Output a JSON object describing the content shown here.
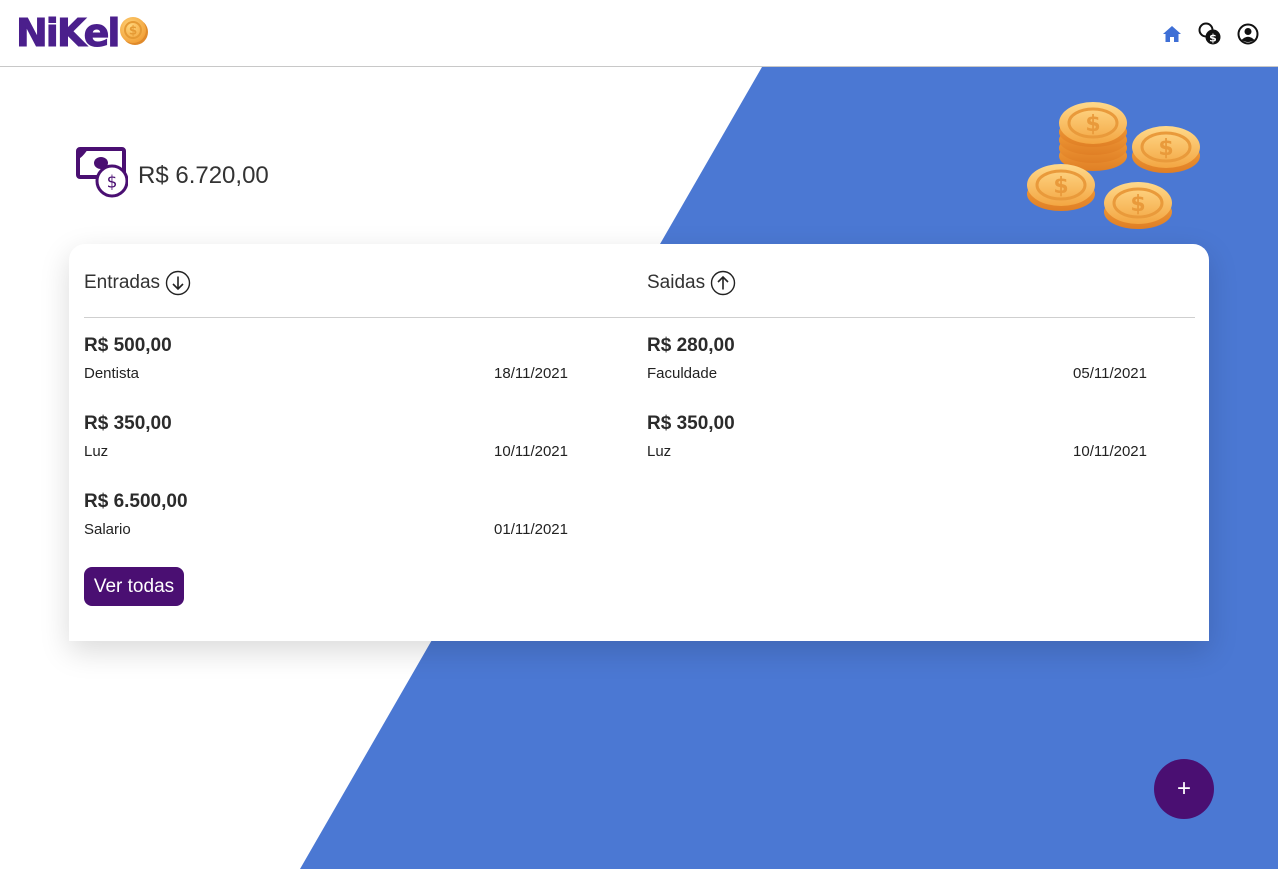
{
  "brand": {
    "name": "NiKel",
    "accent": "#4a0f72",
    "blue": "#4b78d3"
  },
  "nav": {
    "icons": [
      "home-icon",
      "transactions-icon",
      "profile-icon"
    ]
  },
  "balance": {
    "value": "R$ 6.720,00"
  },
  "income": {
    "title": "Entradas",
    "items": [
      {
        "amount": "R$ 500,00",
        "description": "Dentista",
        "date": "18/11/2021"
      },
      {
        "amount": "R$ 350,00",
        "description": "Luz",
        "date": "10/11/2021"
      },
      {
        "amount": "R$ 6.500,00",
        "description": "Salario",
        "date": "01/11/2021"
      }
    ],
    "button": "Ver todas"
  },
  "expenses": {
    "title": "Saidas",
    "items": [
      {
        "amount": "R$ 280,00",
        "description": "Faculdade",
        "date": "05/11/2021"
      },
      {
        "amount": "R$ 350,00",
        "description": "Luz",
        "date": "10/11/2021"
      }
    ]
  },
  "fab": {
    "label": "+"
  }
}
